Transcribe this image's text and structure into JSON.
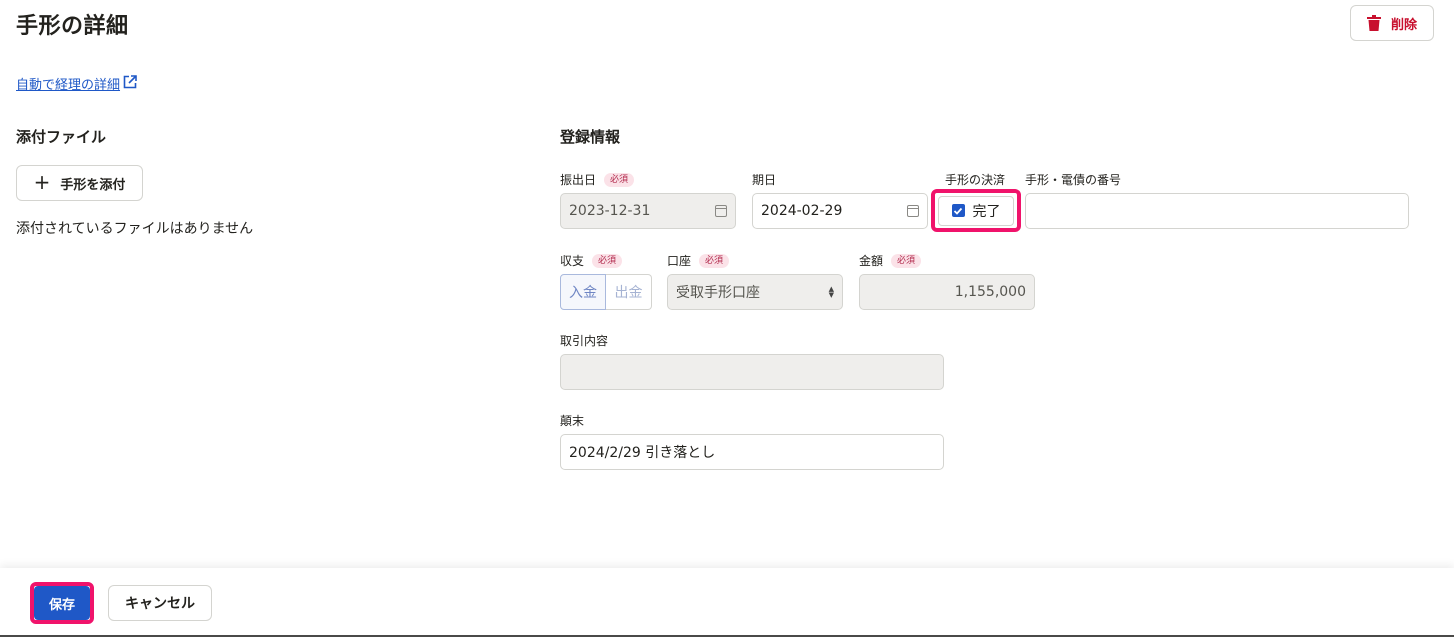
{
  "header": {
    "title": "手形の詳細",
    "delete_label": "削除",
    "detail_link": "自動で経理の詳細"
  },
  "attachments": {
    "title": "添付ファイル",
    "attach_button": "手形を添付",
    "empty_message": "添付されているファイルはありません"
  },
  "registration": {
    "title": "登録情報",
    "required_badge": "必須",
    "issue_date": {
      "label": "振出日",
      "value": "2023-12-31"
    },
    "due_date": {
      "label": "期日",
      "value": "2024-02-29"
    },
    "settlement": {
      "label": "手形の決済",
      "checkbox_label": "完了",
      "checked": true
    },
    "number": {
      "label": "手形・電債の番号",
      "value": ""
    },
    "income_expense": {
      "label": "収支",
      "options": [
        "入金",
        "出金"
      ],
      "selected": "入金"
    },
    "account": {
      "label": "口座",
      "value": "受取手形口座"
    },
    "amount": {
      "label": "金額",
      "value": "1,155,000"
    },
    "transaction": {
      "label": "取引内容",
      "value": ""
    },
    "remarks": {
      "label": "顛末",
      "value": "2024/2/29 引き落とし"
    }
  },
  "footer": {
    "save_label": "保存",
    "cancel_label": "キャンセル"
  },
  "colors": {
    "primary": "#1f58c7",
    "danger": "#c8102e",
    "highlight": "#f0136b",
    "required_bg": "#fbe2e8"
  }
}
